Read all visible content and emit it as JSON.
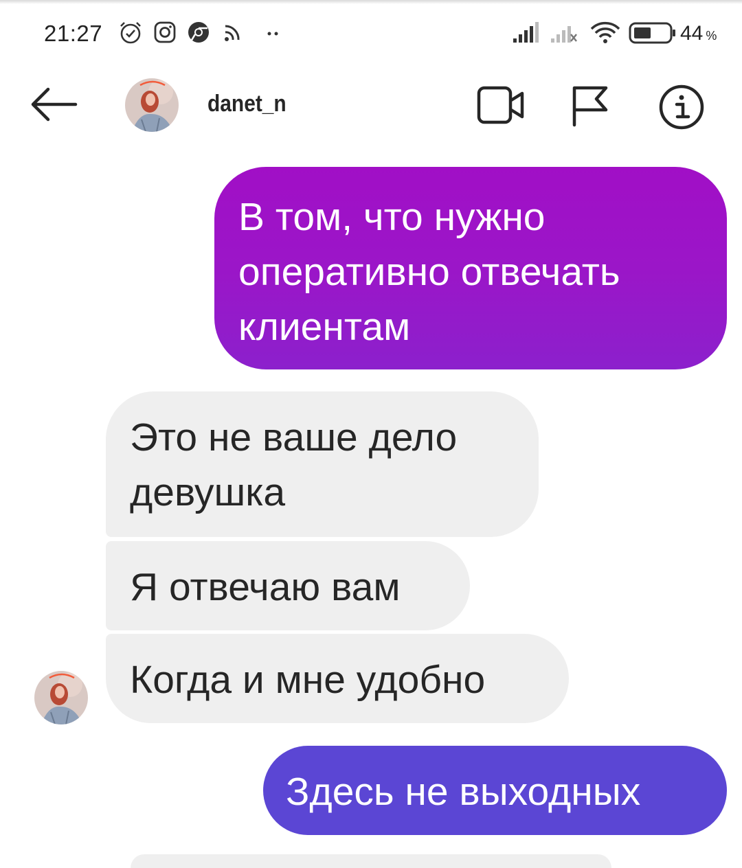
{
  "status_bar": {
    "time": "21:27",
    "battery_percent": "44",
    "percent_sign": "%"
  },
  "header": {
    "username": "danet_n"
  },
  "messages": [
    {
      "direction": "sent",
      "text": "В том, что нужно оперативно отвечать клиентам"
    },
    {
      "direction": "received",
      "text": "Это не ваше дело девушка"
    },
    {
      "direction": "received",
      "text": "Я отвечаю вам"
    },
    {
      "direction": "received",
      "text": "Когда и мне удобно"
    },
    {
      "direction": "sent",
      "text": "Здесь не выходных"
    }
  ],
  "colors": {
    "sent_gradient_top": "#a10fc6",
    "sent_gradient_bottom": "#8c20cc",
    "sent_blue": "#5b46d4",
    "received_bg": "#efefef"
  }
}
